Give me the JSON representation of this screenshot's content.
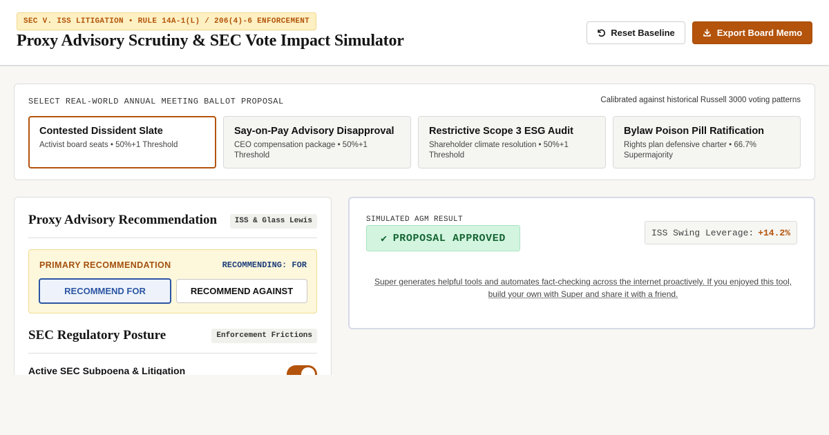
{
  "header": {
    "tag": "SEC V. ISS LITIGATION • RULE 14A-1(L) / 206(4)-6 ENFORCEMENT",
    "title": "Proxy Advisory Scrutiny & SEC Vote Impact Simulator",
    "reset_label": "Reset Baseline",
    "export_label": "Export Board Memo"
  },
  "proposals": {
    "section_label": "SELECT REAL-WORLD ANNUAL MEETING BALLOT PROPOSAL",
    "calibration_note": "Calibrated against historical Russell 3000 voting patterns",
    "selected_index": 0,
    "items": [
      {
        "title": "Contested Dissident Slate",
        "subtitle": "Activist board seats • 50%+1 Threshold"
      },
      {
        "title": "Say-on-Pay Advisory Disapproval",
        "subtitle": "CEO compensation package • 50%+1 Threshold"
      },
      {
        "title": "Restrictive Scope 3 ESG Audit",
        "subtitle": "Shareholder climate resolution • 50%+1 Threshold"
      },
      {
        "title": "Bylaw Poison Pill Ratification",
        "subtitle": "Rights plan defensive charter • 66.7% Supermajority"
      }
    ]
  },
  "advisory": {
    "title": "Proxy Advisory Recommendation",
    "badge": "ISS & Glass Lewis",
    "primary_label": "PRIMARY RECOMMENDATION",
    "status": "RECOMMENDING: FOR",
    "for_label": "RECOMMEND FOR",
    "against_label": "RECOMMEND AGAINST",
    "selected": "for"
  },
  "regulatory": {
    "title": "SEC Regulatory Posture",
    "badge": "Enforcement Frictions",
    "subpoena_label": "Active SEC Subpoena & Litigation",
    "subpoena_on": true
  },
  "result": {
    "label": "SIMULATED AGM RESULT",
    "badge_icon": "✔",
    "badge": "PROPOSAL APPROVED",
    "leverage_label": "ISS Swing Leverage:",
    "leverage_value": "+14.2%",
    "promo": "Super generates helpful tools and automates fact-checking across the internet proactively. If you enjoyed this tool, build your own with Super and share it with a friend."
  },
  "colors": {
    "accent": "#b4530b",
    "approved_bg": "#d3f5e0",
    "approved_text": "#166534",
    "recommend_for": "#2b55a3"
  }
}
